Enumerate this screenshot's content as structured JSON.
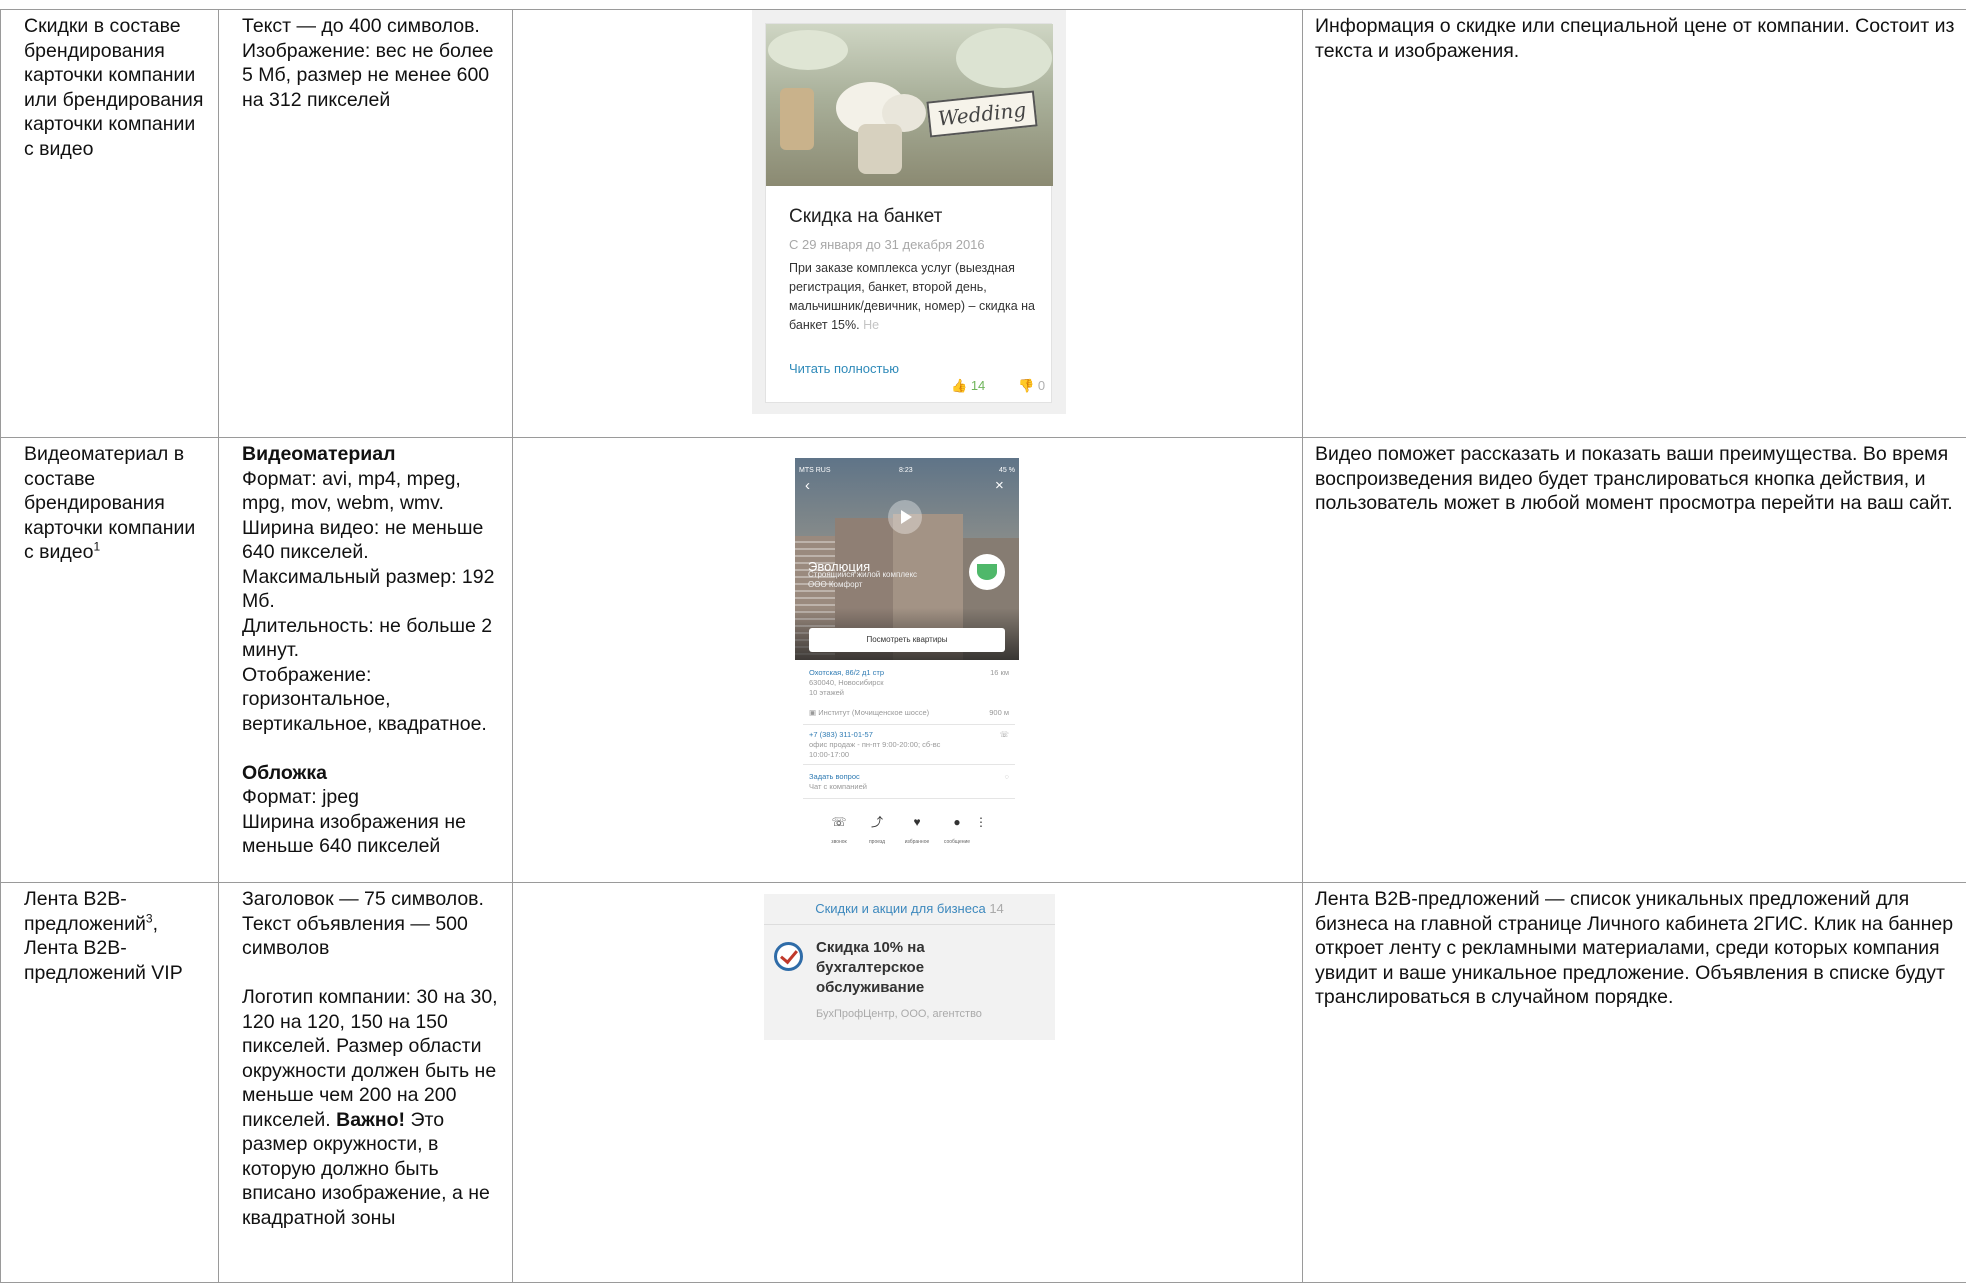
{
  "rows": [
    {
      "name": "Скидки в составе брендирования карточки компании или брендирования карточки компании с видео",
      "requirements": [
        "Текст — до 400 символов.",
        "Изображение: вес не более 5 Мб, размер не менее 600 на 312 пикселей"
      ],
      "description": "Информация о скидке или специальной цене от компании. Состоит из текста и изображения.",
      "mock": {
        "sign_text": "Wedding",
        "title": "Скидка на банкет",
        "dates": "С 29 января до 31 декабря 2016",
        "text": "При заказе комплекса услуг (выездная регистрация, банкет, второй день, мальчишник/девичник, номер) – скидка на банкет 15%.",
        "text_fade": "Не",
        "read_more": "Читать полностью",
        "likes": "14",
        "dislikes": "0"
      }
    },
    {
      "name": "Видеоматериал в составе брендирования карточки компании с видео",
      "name_sup": "1",
      "video_heading": "Видеоматериал",
      "video_lines": [
        "Формат: avi, mp4, mpeg, mpg, mov, webm, wmv.",
        "Ширина видео: не меньше 640 пикселей.",
        "Максимальный размер: 192 Мб.",
        "Длительность: не больше 2 минут.",
        "Отображение: горизонтальное, вертикальное, квадратное."
      ],
      "cover_heading": "Обложка",
      "cover_lines": [
        "Формат: jpeg",
        "Ширина изображения не меньше 640 пикселей"
      ],
      "description": "Видео поможет рассказать и показать ваши преимущества. Во время воспроизведения видео будет транслироваться кнопка действия, и пользователь может в любой момент просмотра перейти на ваш сайт.",
      "mock": {
        "carrier": "MTS RUS",
        "time": "8:23",
        "battery": "45 %",
        "title": "Эволюция",
        "subtitle": "Строящийся жилой комплекс",
        "company": "ООО Комфорт",
        "button": "Посмотреть квартиры",
        "address": "Охотская, 86/2 д1 стр",
        "address_dist": "16 км",
        "address_sub": [
          "630040, Новосибирск",
          "10 этажей"
        ],
        "stop": "Институт (Мочищенское шоссе)",
        "stop_dist": "900 м",
        "phone": "+7 (383) 311-01-57",
        "phone_sub": [
          "офис продаж - пн-пт 9:00-20:00; сб-вс",
          "10:00-17:00"
        ],
        "ask": "Задать вопрос",
        "ask_sub": "Чат с компанией",
        "tabs": [
          "звонок",
          "проезд",
          "избранное",
          "сообщение"
        ]
      }
    },
    {
      "name_1": "Лента B2B-предложений",
      "name_sup": "3",
      "name_2": "Лента B2B-предложений VIP",
      "req_1": [
        "Заголовок — 75 символов.",
        "Текст объявления — 500 символов"
      ],
      "req_2": "Логотип компании: 30 на 30, 120 на 120, 150 на 150 пикселей. Размер области окружности должен быть не меньше чем 200 на 200 пикселей.",
      "req_bold": "Важно!",
      "req_3": "Это размер окружности, в которую должно быть вписано изображение, а не квадратной зоны",
      "description": "Лента B2B-предложений — список уникальных предложений для бизнеса на главной странице Личного кабинета 2ГИС. Клик на баннер откроет ленту с рекламными материалами, среди которых компания увидит и ваше уникальное предложение. Объявления в списке будут транслироваться в случайном порядке.",
      "mock": {
        "header": "Скидки и акции для бизнеса",
        "header_count": "14",
        "offer": "Скидка 10% на бухгалтерское обслуживание",
        "company": "БухПрофЦентр, ООО, агентство"
      }
    }
  ]
}
